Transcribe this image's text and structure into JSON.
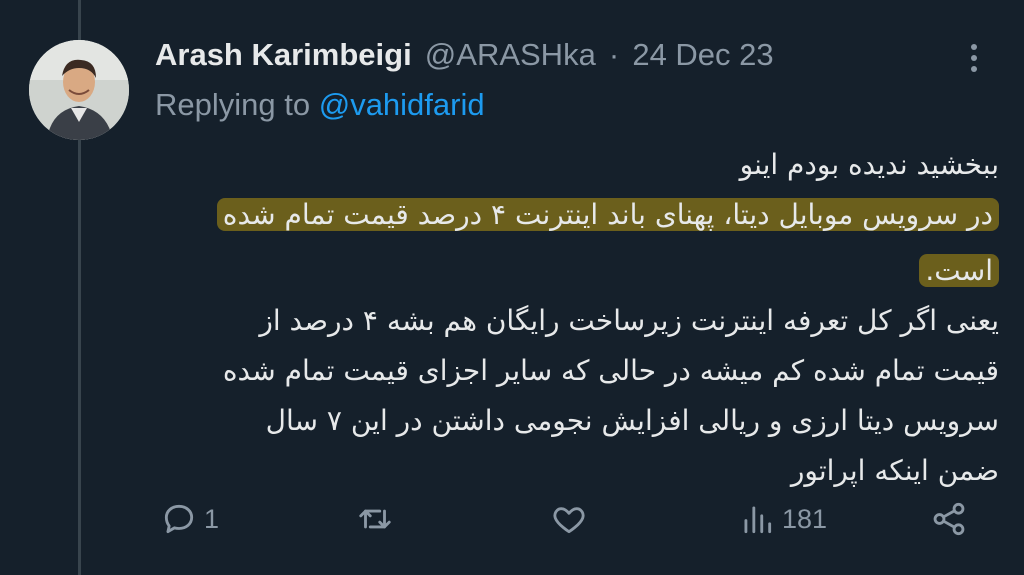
{
  "tweet": {
    "author_name": "Arash Karimbeigi",
    "author_handle": "@ARASHka",
    "separator": "·",
    "date": "24 Dec 23",
    "replying_prefix": "Replying to",
    "replying_to": "@vahidfarid",
    "lines": [
      "ببخشید ندیده بودم اینو",
      "در سرویس موبایل دیتا، پهنای باند اینترنت ۴ درصد قیمت تمام شده",
      "است.",
      "یعنی اگر کل تعرفه اینترنت زیرساخت رایگان هم بشه ۴ درصد از",
      "قیمت تمام شده کم میشه در حالی که سایر اجزای قیمت تمام شده",
      "سرویس دیتا ارزی و ریالی افزایش نجومی داشتن در این ۷ سال",
      "ضمن اینکه اپراتور"
    ],
    "highlight_color": "#6b5f1c"
  },
  "actions": {
    "reply_count": "1",
    "repost_count": "",
    "like_count": "",
    "views_count": "181",
    "icons": [
      "reply-icon",
      "repost-icon",
      "like-icon",
      "views-icon",
      "share-icon"
    ]
  },
  "colors": {
    "background": "#15202b",
    "text": "#e7e9ea",
    "muted": "#8b98a5",
    "link": "#1d9bf0"
  }
}
